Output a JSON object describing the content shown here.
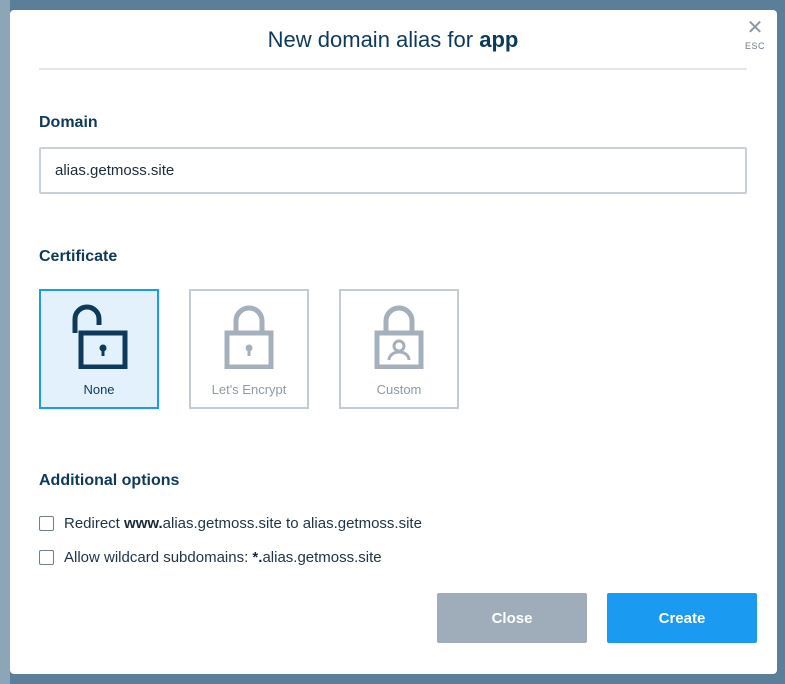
{
  "modal": {
    "title_prefix": "New domain alias for ",
    "title_app": "app",
    "close_hint": "ESC"
  },
  "domain": {
    "label": "Domain",
    "value": "alias.getmoss.site"
  },
  "certificate": {
    "label": "Certificate",
    "options": [
      {
        "label": "None",
        "icon": "unlocked-padlock-icon",
        "selected": true
      },
      {
        "label": "Let's Encrypt",
        "icon": "padlock-icon",
        "selected": false
      },
      {
        "label": "Custom",
        "icon": "padlock-user-icon",
        "selected": false
      }
    ]
  },
  "additional": {
    "label": "Additional options",
    "redirect": {
      "prefix": "Redirect ",
      "bold": "www.",
      "rest": "alias.getmoss.site to alias.getmoss.site",
      "checked": false
    },
    "wildcard": {
      "prefix": "Allow wildcard subdomains: ",
      "bold": "*.",
      "rest": "alias.getmoss.site",
      "checked": false
    }
  },
  "buttons": {
    "close": "Close",
    "create": "Create"
  },
  "colors": {
    "accent": "#1a9af0",
    "title": "#0d3a5b",
    "disabled_button": "#9fadba",
    "selected_card_bg": "#e3f1fd"
  }
}
